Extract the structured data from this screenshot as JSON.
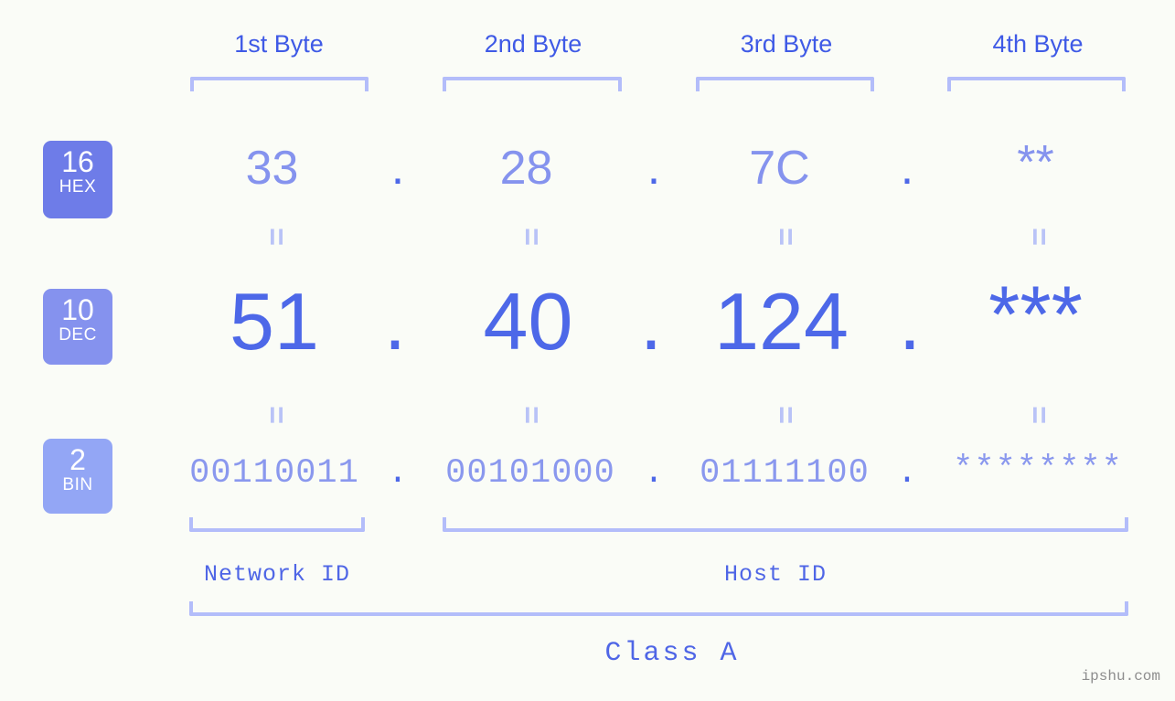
{
  "background_color": "#fafcf7",
  "accent_color": "#4d68e8",
  "bracket_color": "#b3bdfa",
  "columns": [
    {
      "header": "1st Byte"
    },
    {
      "header": "2nd Byte"
    },
    {
      "header": "3rd Byte"
    },
    {
      "header": "4th Byte"
    }
  ],
  "rows": {
    "hex": {
      "base_number": "16",
      "base_name": "HEX",
      "badge_color": "#6e7ce8",
      "values": [
        "33",
        "28",
        "7C",
        "**"
      ],
      "separator": "."
    },
    "dec": {
      "base_number": "10",
      "base_name": "DEC",
      "badge_color": "#8592ee",
      "values": [
        "51",
        "40",
        "124",
        "***"
      ],
      "separator": "."
    },
    "bin": {
      "base_number": "2",
      "base_name": "BIN",
      "badge_color": "#93a6f5",
      "values": [
        "00110011",
        "00101000",
        "01111100",
        "********"
      ],
      "separator": "."
    }
  },
  "equality_mark": "=",
  "segments": {
    "network_id": "Network ID",
    "host_id": "Host ID"
  },
  "class_label": "Class A",
  "watermark": "ipshu.com"
}
